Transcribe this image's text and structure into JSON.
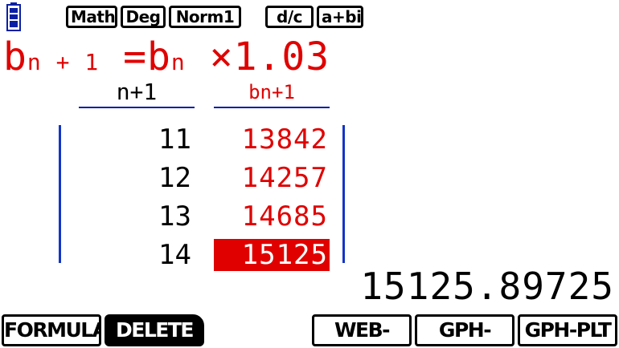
{
  "status_bar": {
    "tags": [
      "Math",
      "Deg",
      "Norm1",
      "d/c",
      "a+bi"
    ]
  },
  "formula": {
    "lhs_b": "b",
    "lhs_sub": "n + 1",
    "eq": "=",
    "rhs_b": "b",
    "rhs_sub": "n",
    "op": "×1.03"
  },
  "table": {
    "headers": {
      "n": "n+1",
      "b": "bn+1"
    },
    "rows": [
      {
        "n": "11",
        "b": "13842"
      },
      {
        "n": "12",
        "b": "14257"
      },
      {
        "n": "13",
        "b": "14685"
      },
      {
        "n": "14",
        "b": "15125"
      }
    ],
    "selected_row": 3
  },
  "result_value": "15125.89725",
  "function_keys": [
    "FORMULA",
    "DELETE",
    "WEB-GPH",
    "GPH-CON",
    "GPH-PLT"
  ],
  "colors": {
    "accent_red": "#e00000",
    "line_blue": "#0b1fa6"
  },
  "icons": {
    "battery": "battery-icon"
  }
}
